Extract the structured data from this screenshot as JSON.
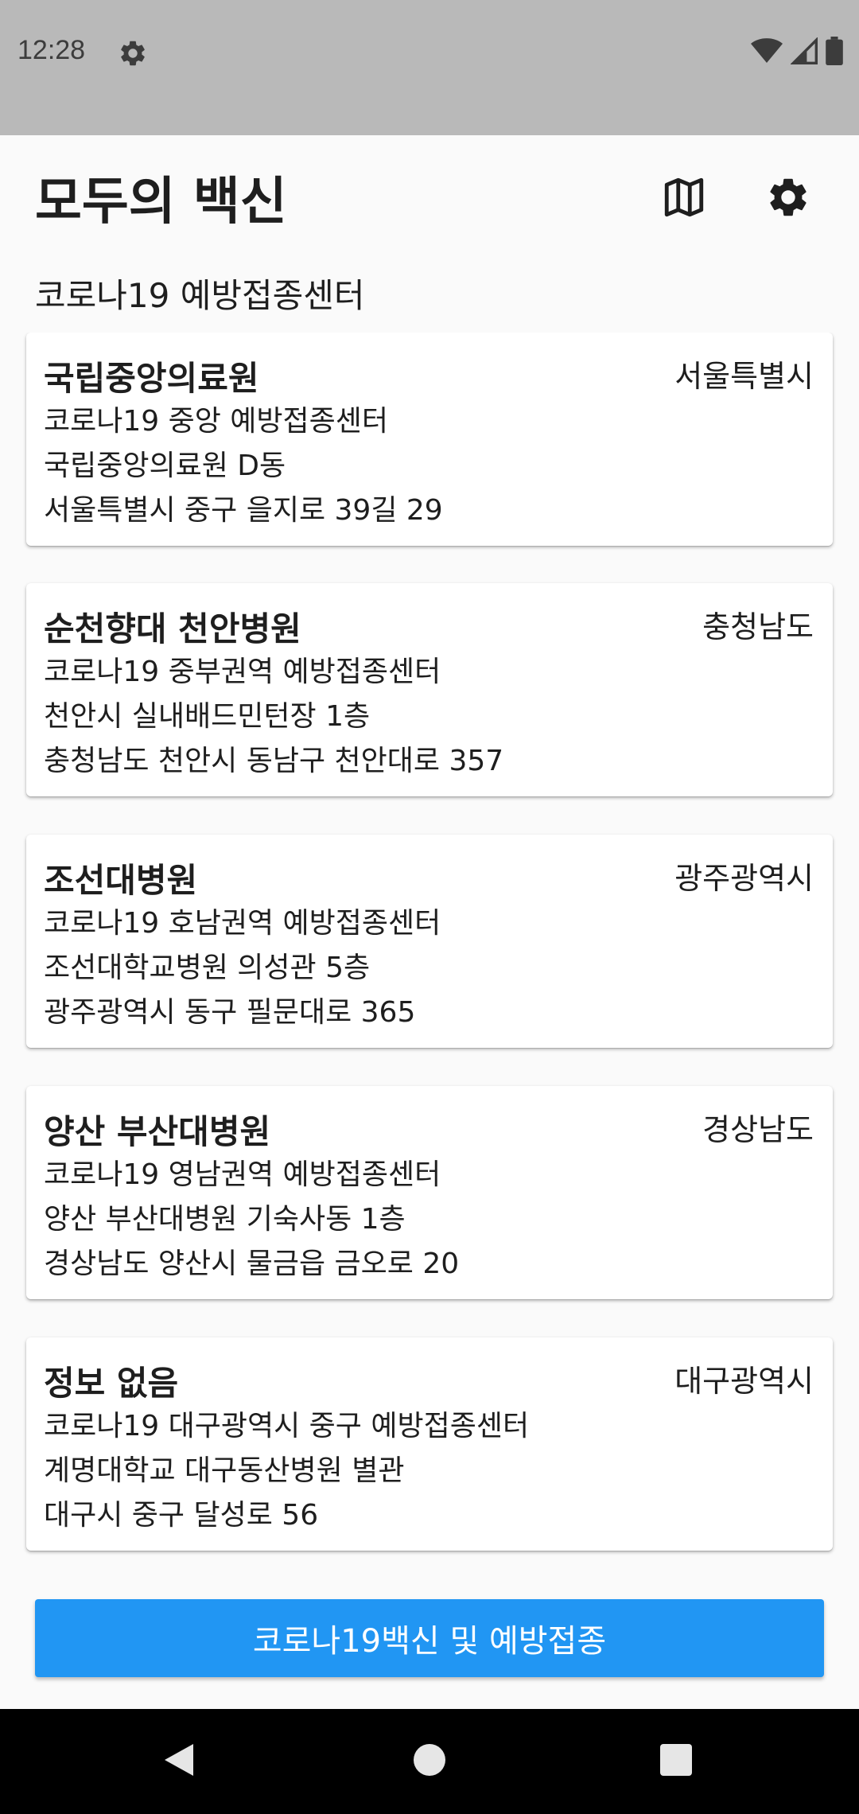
{
  "status_bar": {
    "time": "12:28",
    "left_icons": [
      "gear-icon"
    ],
    "right_icons": [
      "wifi-icon",
      "signal-icon",
      "battery-icon"
    ]
  },
  "app_bar": {
    "title": "모두의 백신",
    "actions": [
      {
        "icon": "map-icon"
      },
      {
        "icon": "gear-icon"
      }
    ]
  },
  "section_title": "코로나19 예방접종센터",
  "centers": [
    {
      "name": "국립중앙의료원",
      "region": "서울특별시",
      "center_name": "코로나19 중앙 예방접종센터",
      "facility": "국립중앙의료원 D동",
      "address": "서울특별시 중구 을지로 39길 29"
    },
    {
      "name": "순천향대 천안병원",
      "region": "충청남도",
      "center_name": "코로나19 중부권역 예방접종센터",
      "facility": "천안시 실내배드민턴장 1층",
      "address": "충청남도 천안시 동남구 천안대로 357"
    },
    {
      "name": "조선대병원",
      "region": "광주광역시",
      "center_name": "코로나19 호남권역 예방접종센터",
      "facility": "조선대학교병원 의성관 5층",
      "address": "광주광역시 동구 필문대로 365"
    },
    {
      "name": "양산 부산대병원",
      "region": "경상남도",
      "center_name": "코로나19 영남권역 예방접종센터",
      "facility": "양산 부산대병원 기숙사동 1층",
      "address": "경상남도 양산시 물금읍 금오로 20"
    },
    {
      "name": "정보 없음",
      "region": "대구광역시",
      "center_name": "코로나19 대구광역시 중구 예방접종센터",
      "facility": "계명대학교 대구동산병원 별관",
      "address": "대구시 중구 달성로 56"
    }
  ],
  "bottom_button": {
    "label": "코로나19백신 및 예방접종",
    "color": "#2196f3"
  },
  "nav_bar": {
    "buttons": [
      "back-icon",
      "home-icon",
      "recents-icon"
    ]
  }
}
